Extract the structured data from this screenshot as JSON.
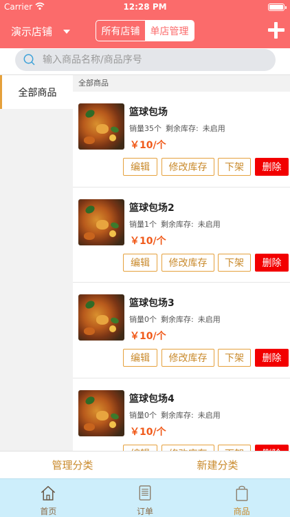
{
  "status_bar": {
    "carrier": "Carrier",
    "time": "12:28 PM"
  },
  "nav": {
    "store_name": "演示店铺",
    "segments": [
      "所有店铺",
      "单店管理"
    ],
    "active_segment": "单店管理"
  },
  "search": {
    "placeholder": "输入商品名称/商品序号"
  },
  "categories": [
    {
      "label": "全部商品",
      "selected": true
    }
  ],
  "list": {
    "header": "全部商品",
    "products": [
      {
        "name": "篮球包场",
        "sales": "销量35个",
        "stock_label": "剩余库存:",
        "stock_value": "未启用",
        "price": "￥10/个"
      },
      {
        "name": "篮球包场2",
        "sales": "销量1个",
        "stock_label": "剩余库存:",
        "stock_value": "未启用",
        "price": "￥10/个"
      },
      {
        "name": "篮球包场3",
        "sales": "销量0个",
        "stock_label": "剩余库存:",
        "stock_value": "未启用",
        "price": "￥10/个"
      },
      {
        "name": "篮球包场4",
        "sales": "销量0个",
        "stock_label": "剩余库存:",
        "stock_value": "未启用",
        "price": "￥10/个"
      }
    ],
    "buttons": {
      "edit": "编辑",
      "stock": "修改库存",
      "off_shelf": "下架",
      "delete": "删除"
    }
  },
  "bottom_actions": {
    "manage": "管理分类",
    "create": "新建分类"
  },
  "tabs": [
    {
      "label": "首页",
      "icon": "home-icon"
    },
    {
      "label": "订单",
      "icon": "order-icon"
    },
    {
      "label": "商品",
      "icon": "product-icon"
    }
  ],
  "colors": {
    "brand": "#fb6b6b",
    "accent": "#e5a03b",
    "delete": "#f20000",
    "price": "#f05a1a",
    "tab_bar": "#cdeefb"
  }
}
